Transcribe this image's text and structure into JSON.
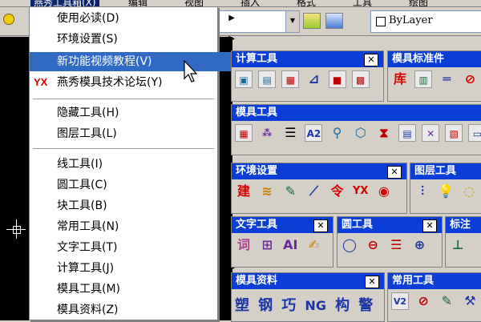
{
  "menubar": {
    "items": [
      "燕秀工具箱(X)",
      "编辑",
      "视图",
      "插入",
      "格式",
      "工具",
      "绘图"
    ]
  },
  "toolbar": {
    "layer_combo_value": "ByLayer"
  },
  "menu": {
    "items": [
      {
        "label": "使用必读(D)",
        "submenu": true
      },
      {
        "label": "环境设置(S)",
        "submenu": true
      },
      {
        "label": "新功能视频教程(V)",
        "submenu": false,
        "highlighted": true
      },
      {
        "label": "燕秀模具技术论坛(Y)",
        "submenu": false,
        "logo": "YX"
      },
      {
        "label": "隐藏工具(H)",
        "submenu": true
      },
      {
        "label": "图层工具(L)",
        "submenu": true
      },
      {
        "label": "线工具(I)",
        "submenu": true
      },
      {
        "label": "圆工具(C)",
        "submenu": true
      },
      {
        "label": "块工具(B)",
        "submenu": true
      },
      {
        "label": "常用工具(N)",
        "submenu": true
      },
      {
        "label": "文字工具(T)",
        "submenu": true
      },
      {
        "label": "计算工具(J)",
        "submenu": true
      },
      {
        "label": "模具工具(M)",
        "submenu": true
      },
      {
        "label": "模具资料(Z)",
        "submenu": true
      }
    ]
  },
  "panels": {
    "calc": {
      "title": "计算工具",
      "close": "✕"
    },
    "mold_std": {
      "title": "模具标准件"
    },
    "mold_tools": {
      "title": "模具工具"
    },
    "env": {
      "title": "环境设置",
      "close": "✕"
    },
    "layer": {
      "title": "图层工具"
    },
    "text": {
      "title": "文字工具",
      "close": "✕"
    },
    "circle": {
      "title": "圆工具",
      "close": "✕"
    },
    "annot": {
      "title": "标注"
    },
    "mold_data": {
      "title": "模具资料",
      "close": "✕"
    },
    "common": {
      "title": "常用工具"
    }
  },
  "icon_text": {
    "std_lib": "库",
    "env_build": "建",
    "env_order": "令",
    "env_yx": "YX",
    "text_ci": "词",
    "text_ai": "AI",
    "text_a2": "A2",
    "common_v2": "V2",
    "mold_data_glyphs": [
      "塑",
      "钢",
      "巧",
      "NG",
      "构",
      "警"
    ]
  },
  "colors": {
    "title_bar": "#0a3ed6",
    "menu_highlight": "#316ac5",
    "logo_red": "#d40000"
  }
}
